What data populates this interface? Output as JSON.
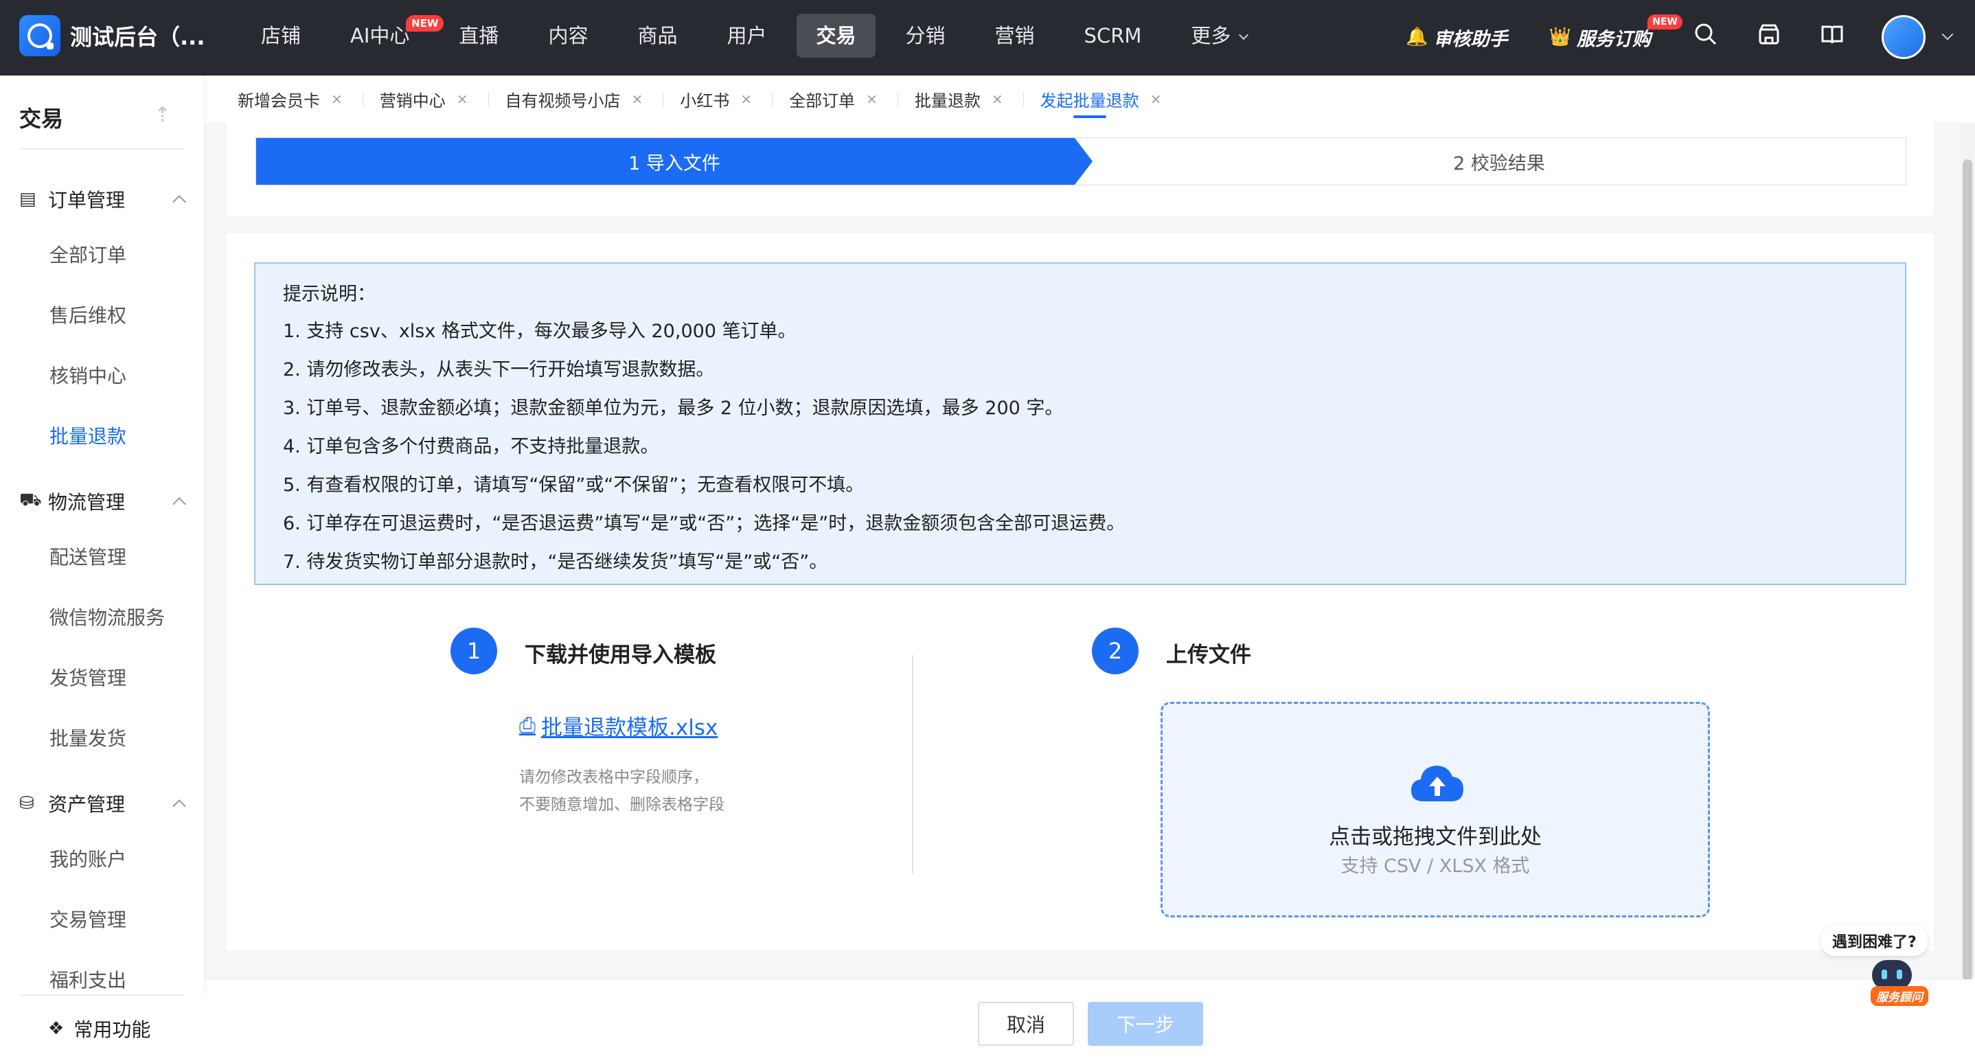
{
  "app": {
    "title": "测试后台（...",
    "nav": [
      {
        "label": "店铺",
        "badge": ""
      },
      {
        "label": "AI中心",
        "badge": "NEW"
      },
      {
        "label": "直播",
        "badge": ""
      },
      {
        "label": "内容",
        "badge": ""
      },
      {
        "label": "商品",
        "badge": ""
      },
      {
        "label": "用户",
        "badge": ""
      },
      {
        "label": "交易",
        "badge": ""
      },
      {
        "label": "分销",
        "badge": ""
      },
      {
        "label": "营销",
        "badge": ""
      },
      {
        "label": "SCRM",
        "badge": ""
      },
      {
        "label": "更多",
        "badge": ""
      }
    ],
    "top_right": {
      "review_helper": "审核助手",
      "service_order": "服务订购",
      "service_badge": "NEW"
    }
  },
  "sidebar": {
    "header": "交易",
    "groups": [
      {
        "label": "订单管理",
        "icon": "order-icon",
        "items": [
          "全部订单",
          "售后维权",
          "核销中心",
          "批量退款"
        ]
      },
      {
        "label": "物流管理",
        "icon": "truck-icon",
        "items": [
          "配送管理",
          "微信物流服务",
          "发货管理",
          "批量发货"
        ]
      },
      {
        "label": "资产管理",
        "icon": "asset-icon",
        "items": [
          "我的账户",
          "交易管理",
          "福利支出"
        ]
      }
    ],
    "active_item": "批量退款",
    "common": "常用功能"
  },
  "tabs": [
    "新增会员卡",
    "营销中心",
    "自有视频号小店",
    "小红书",
    "全部订单",
    "批量退款",
    "发起批量退款"
  ],
  "active_tab": "发起批量退款",
  "steps": [
    "1 导入文件",
    "2 校验结果"
  ],
  "tips": {
    "title": "提示说明：",
    "items": [
      "1. 支持 csv、xlsx 格式文件，每次最多导入 20,000 笔订单。",
      "2. 请勿修改表头，从表头下一行开始填写退款数据。",
      "3. 订单号、退款金额必填；退款金额单位为元，最多 2 位小数；退款原因选填，最多 200 字。",
      "4. 订单包含多个付费商品，不支持批量退款。",
      "5. 有查看权限的订单，请填写“保留”或“不保留”；无查看权限可不填。",
      "6. 订单存在可退运费时，“是否退运费”填写“是”或“否”；选择“是”时，退款金额须包含全部可退运费。",
      "7. 待发货实物订单部分退款时，“是否继续发货”填写“是”或“否”。"
    ]
  },
  "download": {
    "num": "1",
    "title": "下载并使用导入模板",
    "link": "批量退款模板.xlsx",
    "note1": "请勿修改表格中字段顺序，",
    "note2": "不要随意增加、删除表格字段"
  },
  "upload": {
    "num": "2",
    "title": "上传文件",
    "main": "点击或拖拽文件到此处",
    "sub": "支持 CSV / XLSX 格式"
  },
  "buttons": {
    "cancel": "取消",
    "next": "下一步"
  },
  "helper": {
    "bubble": "遇到困难了?",
    "tag": "服务顾问"
  },
  "colors": {
    "primary": "#1b6cf2",
    "topbar": "#272a31",
    "tips_bg": "#eaf3fd"
  }
}
